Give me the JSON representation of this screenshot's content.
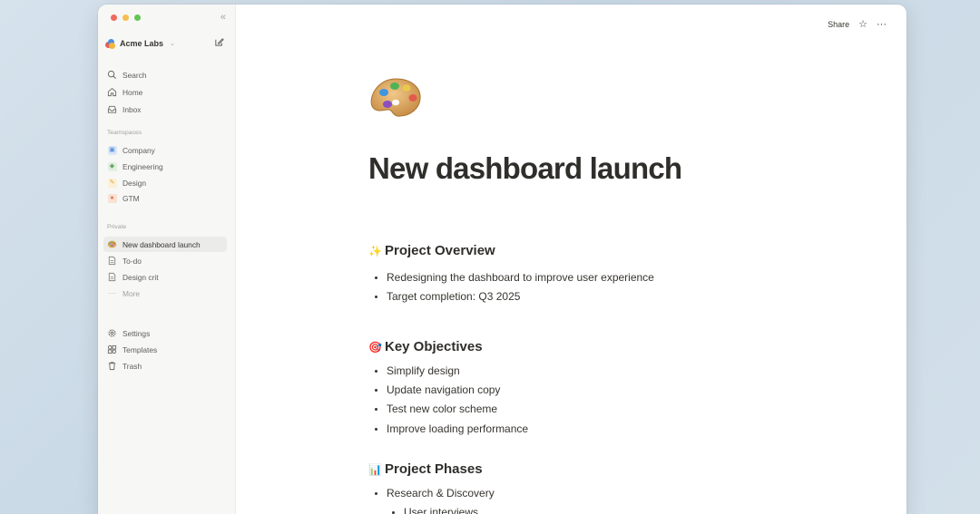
{
  "sidebar": {
    "workspace_name": "Acme Labs",
    "nav": [
      {
        "label": "Search",
        "icon": "search-icon"
      },
      {
        "label": "Home",
        "icon": "home-icon"
      },
      {
        "label": "Inbox",
        "icon": "inbox-icon"
      }
    ],
    "teamspaces_label": "Teamspaces",
    "teamspaces": [
      {
        "label": "Company",
        "icon": "building-icon",
        "color": "#5b8fd6"
      },
      {
        "label": "Engineering",
        "icon": "shield-icon",
        "color": "#6aa96a"
      },
      {
        "label": "Design",
        "icon": "pencil-icon",
        "color": "#e0a83a"
      },
      {
        "label": "GTM",
        "icon": "megaphone-icon",
        "color": "#e07b4a"
      }
    ],
    "private_label": "Private",
    "private": [
      {
        "label": "New dashboard launch",
        "icon": "palette-icon",
        "active": true
      },
      {
        "label": "To-do",
        "icon": "page-icon"
      },
      {
        "label": "Design crit",
        "icon": "page-icon"
      },
      {
        "label": "More",
        "icon": "ellipsis-icon"
      }
    ],
    "footer": [
      {
        "label": "Settings",
        "icon": "gear-icon"
      },
      {
        "label": "Templates",
        "icon": "templates-icon"
      },
      {
        "label": "Trash",
        "icon": "trash-icon"
      }
    ]
  },
  "topbar": {
    "share_label": "Share"
  },
  "page": {
    "icon": "palette-icon",
    "title": "New dashboard launch",
    "sections": [
      {
        "emoji": "✨",
        "heading": "Project Overview",
        "bullets": [
          "Redesigning the dashboard to improve user experience",
          "Target completion: Q3 2025"
        ]
      },
      {
        "emoji": "🎯",
        "heading": "Key Objectives",
        "bullets": [
          "Simplify design",
          "Update navigation copy",
          "Test new color scheme",
          "Improve loading performance"
        ]
      },
      {
        "emoji": "📊",
        "heading": "Project Phases",
        "bullets": [
          "Research & Discovery"
        ],
        "sub_bullets": [
          "User interviews"
        ]
      }
    ]
  }
}
